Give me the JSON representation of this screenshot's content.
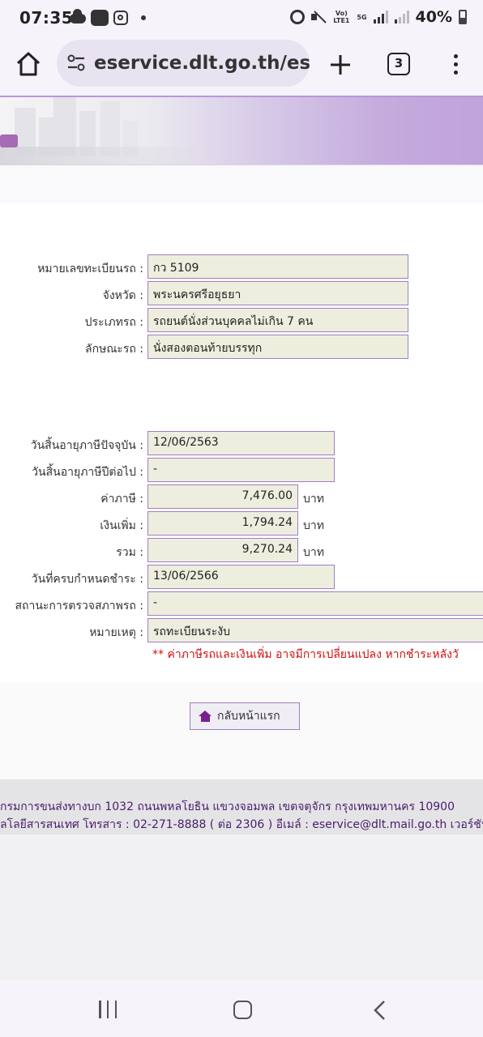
{
  "status_bar": {
    "time": "07:35",
    "volte": "Vo) LTE1",
    "network": "5G",
    "battery": "40%"
  },
  "browser": {
    "url": "eservice.dlt.go.th/esva",
    "tab_count": "3",
    "icons": [
      "home-icon",
      "site-settings-icon",
      "plus-icon",
      "tabs-icon",
      "more-vert-icon"
    ]
  },
  "vehicle": {
    "plate_label": "หมายเลขทะเบียนรถ :",
    "plate": "กว 5109",
    "province_label": "จังหวัด :",
    "province": "พระนครศรีอยุธยา",
    "type_label": "ประเภทรถ :",
    "type": "รถยนต์นั่งส่วนบุคคลไม่เกิน 7 คน",
    "style_label": "ลักษณะรถ :",
    "style": "นั่งสองตอนท้ายบรรทุก"
  },
  "tax": {
    "current_expiry_label": "วันสิ้นอายุภาษีปัจจุบัน :",
    "current_expiry": "12/06/2563",
    "next_expiry_label": "วันสิ้นอายุภาษีปีต่อไป :",
    "next_expiry": "-",
    "tax_label": "ค่าภาษี :",
    "tax_amount": "7,476.00",
    "surcharge_label": "เงินเพิ่ม :",
    "surcharge": "1,794.24",
    "total_label": "รวม :",
    "total": "9,270.24",
    "unit": "บาท",
    "due_date_label": "วันที่ครบกำหนดชำระ :",
    "due_date": "13/06/2566",
    "inspection_label": "สถานะการตรวจสภาพรถ :",
    "inspection": "-",
    "remark_label": "หมายเหตุ :",
    "remark": "รถทะเบียนระงับ",
    "warning": "** ค่าภาษีรถและเงินเพิ่ม อาจมีการเปลี่ยนแปลง หากชำระหลังวั"
  },
  "back_button": {
    "label": "กลับหน้าแรก"
  },
  "footer": {
    "line1": "กรมการขนส่งทางบก 1032 ถนนพหลโยธิน แขวงจอมพล เขตจตุจักร กรุงเทพมหานคร 10900",
    "line2": "ลโลยีสารสนเทศ โทรสาร : 02-271-8888 ( ต่อ 2306 ) อีเมล์ : eservice@dlt.mail.go.th เวอร์ชัน"
  },
  "colors": {
    "accent_purple": "#9f7fc2",
    "field_bg": "#eeeedf",
    "warning_red": "#d01010",
    "footer_text": "#4a1c6b"
  }
}
